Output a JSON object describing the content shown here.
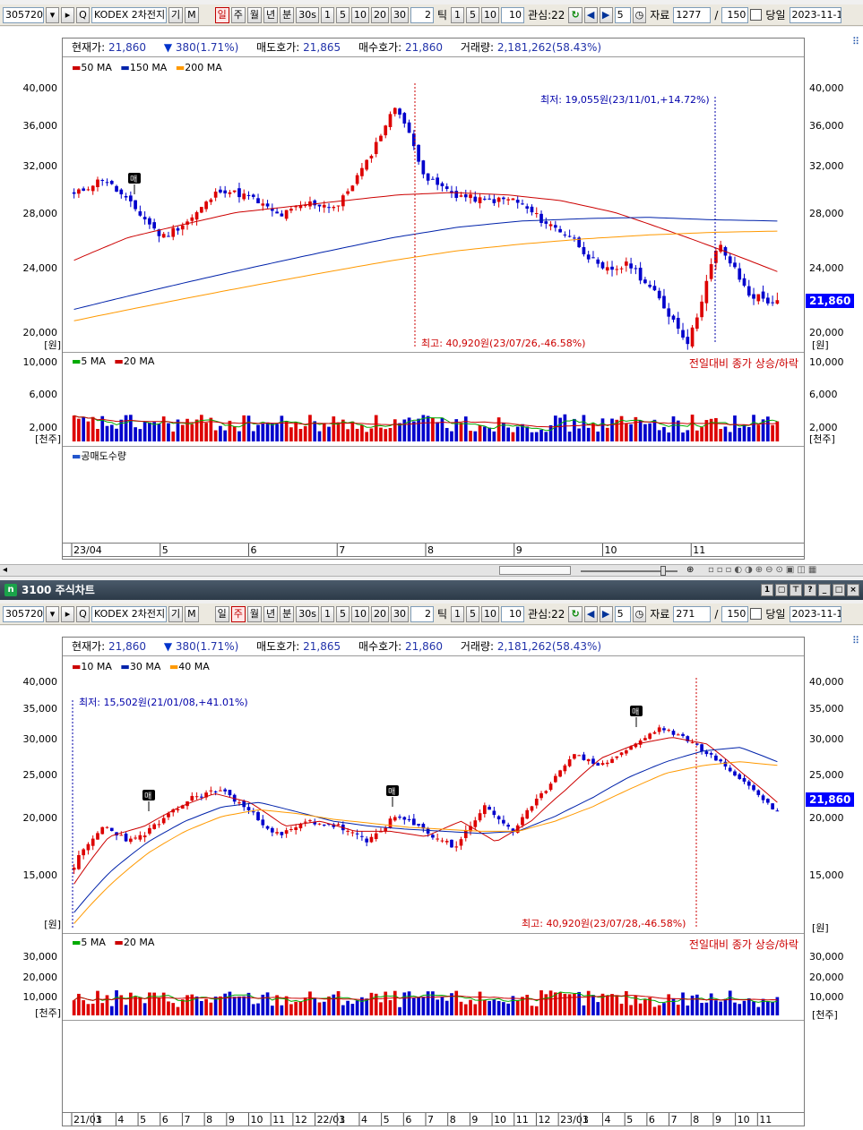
{
  "toolbar": {
    "code": "305720",
    "name": "KODEX 2차전지",
    "name_suffix": "기",
    "m_btn": "M",
    "periods": [
      "일",
      "주",
      "월",
      "년",
      "분"
    ],
    "min_values": [
      "30s",
      "1",
      "5",
      "10",
      "20",
      "30"
    ],
    "tick_value": "2",
    "tick_label": "틱",
    "tick_values": [
      "1",
      "5",
      "10",
      "10"
    ],
    "interest_label": "관심:22",
    "num5": "5",
    "data_label": "자료",
    "slash": "/",
    "view_count": "150",
    "today_label": "당일",
    "date": "2023-11-1"
  },
  "panel1": {
    "data_count": "1277",
    "info": {
      "cur_label": "현재가:",
      "cur_val": "21,860",
      "chg_val": "380(1.71%)",
      "ask_label": "매도호가:",
      "ask_val": "21,865",
      "bid_label": "매수호가:",
      "bid_val": "21,860",
      "vol_label": "거래량:",
      "vol_val": "2,181,262(58.43%)"
    },
    "ma_legend": [
      "50 MA",
      "150 MA",
      "200 MA"
    ],
    "y_ticks": [
      "40,000",
      "36,000",
      "32,000",
      "28,000",
      "24,000",
      "20,000"
    ],
    "won": "[원]",
    "low_note": "최저: 19,055원(23/11/01,+14.72%)",
    "high_note": "최고: 40,920원(23/07/26,-46.58%)",
    "current_price": "21,860",
    "vol_legend": [
      "5 MA",
      "20 MA"
    ],
    "vol_right_note": "전일대비 종가 상승/하락",
    "vol_ticks": [
      "10,000",
      "6,000",
      "2,000"
    ],
    "thousand": "[천주]",
    "short_label": "공매도수량",
    "x_labels": [
      "23/04",
      "5",
      "6",
      "7",
      "8",
      "9",
      "10",
      "11"
    ],
    "buy_tag": "매"
  },
  "panel2": {
    "title": "3100 주식차트",
    "title_icon": "n",
    "data_count": "271",
    "info": {
      "cur_label": "현재가:",
      "cur_val": "21,860",
      "chg_val": "380(1.71%)",
      "ask_label": "매도호가:",
      "ask_val": "21,865",
      "bid_label": "매수호가:",
      "bid_val": "21,860",
      "vol_label": "거래량:",
      "vol_val": "2,181,262(58.43%)"
    },
    "ma_legend": [
      "10 MA",
      "30 MA",
      "40 MA"
    ],
    "y_ticks": [
      "40,000",
      "35,000",
      "30,000",
      "25,000",
      "20,000",
      "15,000"
    ],
    "won": "[원]",
    "low_note": "최저: 15,502원(21/01/08,+41.01%)",
    "high_note": "최고: 40,920원(23/07/28,-46.58%)",
    "current_price": "21,860",
    "vol_legend": [
      "5 MA",
      "20 MA"
    ],
    "vol_right_note": "전일대비 종가 상승/하락",
    "vol_ticks": [
      "30,000",
      "20,000",
      "10,000"
    ],
    "thousand": "[천주]",
    "x_labels": [
      "21/01",
      "3",
      "4",
      "5",
      "6",
      "7",
      "8",
      "9",
      "10",
      "11",
      "12",
      "22/01",
      "3",
      "4",
      "5",
      "6",
      "7",
      "8",
      "9",
      "10",
      "11",
      "12",
      "23/01",
      "3",
      "4",
      "5",
      "6",
      "7",
      "8",
      "9",
      "10",
      "11"
    ],
    "buy_tag": "매"
  },
  "colors": {
    "up": "#dd0000",
    "down": "#0000cc",
    "ma_red": "#cc0000",
    "ma_blue": "#0022aa",
    "ma_orange": "#ff9900",
    "vol_ma5": "#00aa00"
  },
  "icons": [
    "dropdown-icon",
    "arrow-right-icon",
    "search-icon",
    "refresh-icon",
    "prev-icon",
    "next-icon",
    "clock-icon",
    "zoom-icon",
    "settings-icon"
  ]
}
